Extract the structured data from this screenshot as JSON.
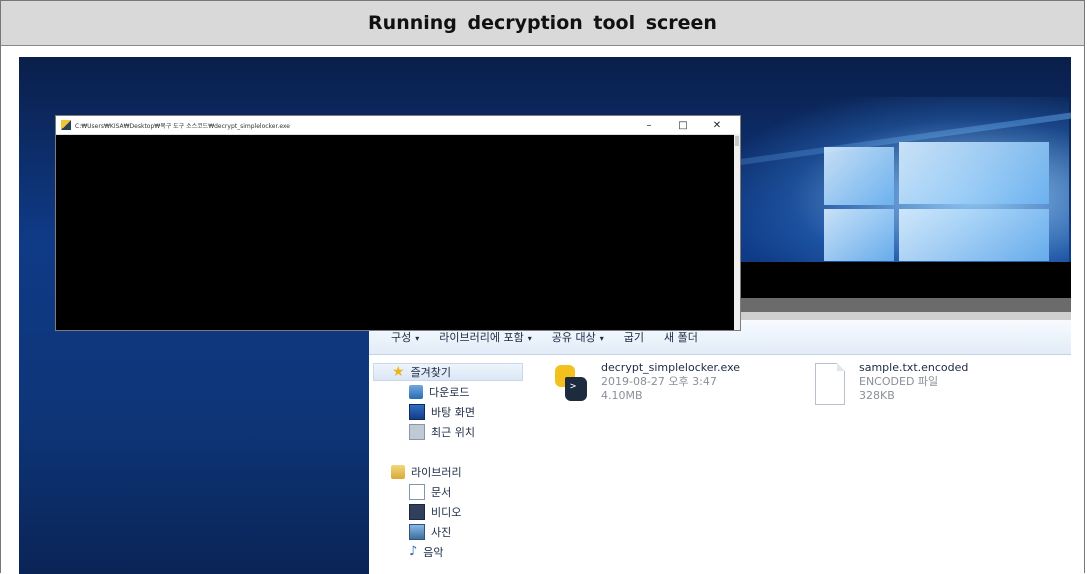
{
  "caption": "Running decryption tool screen",
  "console": {
    "title": "C:₩Users₩KISA₩Desktop₩복구 도구 소스코드₩decrypt_simplelocker.exe",
    "minimize": "–",
    "maximize": "□",
    "close": "✕"
  },
  "explorer": {
    "toolbar": {
      "organize": "구성",
      "include_library": "라이브러리에 포함",
      "share_with": "공유 대상",
      "burn": "굽기",
      "new_folder": "새 폴더",
      "caret": "▾"
    },
    "nav": {
      "favorites": "즐겨찾기",
      "downloads": "다운로드",
      "desktop": "바탕 화면",
      "recent": "최근 위치",
      "libraries": "라이브러리",
      "documents": "문서",
      "videos": "비디오",
      "pictures": "사진",
      "music": "음악"
    },
    "files": [
      {
        "name": "decrypt_simplelocker.exe",
        "date": "2019-08-27 오후 3:47",
        "size": "4.10MB",
        "icon": "python-exe-icon"
      },
      {
        "name": "sample.txt.encoded",
        "type": "ENCODED 파일",
        "size": "328KB",
        "icon": "file-icon"
      }
    ]
  }
}
